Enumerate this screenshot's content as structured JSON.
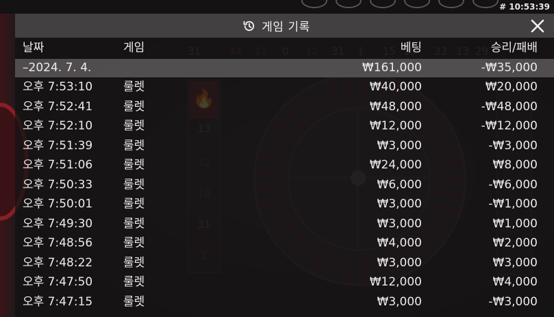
{
  "clock": "# 10:53:39",
  "bg": {
    "top_numbers": [
      "31",
      "34",
      "12",
      "0",
      "12",
      "31",
      "1",
      "15",
      "10",
      "33",
      "13",
      "29"
    ],
    "history_numbers": [
      "13",
      "12",
      "18",
      "31",
      "1"
    ]
  },
  "modal": {
    "title": "게임 기록",
    "icon": "history-icon",
    "close_icon": "close-icon",
    "columns": {
      "date": "날짜",
      "game": "게임",
      "bet": "베팅",
      "win_loss": "승리/패배"
    },
    "summary": {
      "date": "–2024. 7. 4.",
      "bet": "₩161,000",
      "win_loss": "-₩35,000"
    },
    "rows": [
      {
        "time": "오후 7:53:10",
        "game": "룰렛",
        "bet": "₩40,000",
        "result": "₩20,000"
      },
      {
        "time": "오후 7:52:41",
        "game": "룰렛",
        "bet": "₩48,000",
        "result": "-₩48,000"
      },
      {
        "time": "오후 7:52:10",
        "game": "룰렛",
        "bet": "₩12,000",
        "result": "-₩12,000"
      },
      {
        "time": "오후 7:51:39",
        "game": "룰렛",
        "bet": "₩3,000",
        "result": "-₩3,000"
      },
      {
        "time": "오후 7:51:06",
        "game": "룰렛",
        "bet": "₩24,000",
        "result": "₩8,000"
      },
      {
        "time": "오후 7:50:33",
        "game": "룰렛",
        "bet": "₩6,000",
        "result": "-₩6,000"
      },
      {
        "time": "오후 7:50:01",
        "game": "룰렛",
        "bet": "₩3,000",
        "result": "-₩1,000"
      },
      {
        "time": "오후 7:49:30",
        "game": "룰렛",
        "bet": "₩3,000",
        "result": "₩1,000"
      },
      {
        "time": "오후 7:48:56",
        "game": "룰렛",
        "bet": "₩4,000",
        "result": "₩2,000"
      },
      {
        "time": "오후 7:48:22",
        "game": "룰렛",
        "bet": "₩3,000",
        "result": "₩3,000"
      },
      {
        "time": "오후 7:47:50",
        "game": "룰렛",
        "bet": "₩12,000",
        "result": "₩4,000"
      },
      {
        "time": "오후 7:47:15",
        "game": "룰렛",
        "bet": "₩3,000",
        "result": "-₩3,000"
      }
    ]
  },
  "colors": {
    "header_bg": "#484445",
    "summary_bg": "#5c5859",
    "text": "#ececec",
    "accent_red": "#8a1e22"
  }
}
